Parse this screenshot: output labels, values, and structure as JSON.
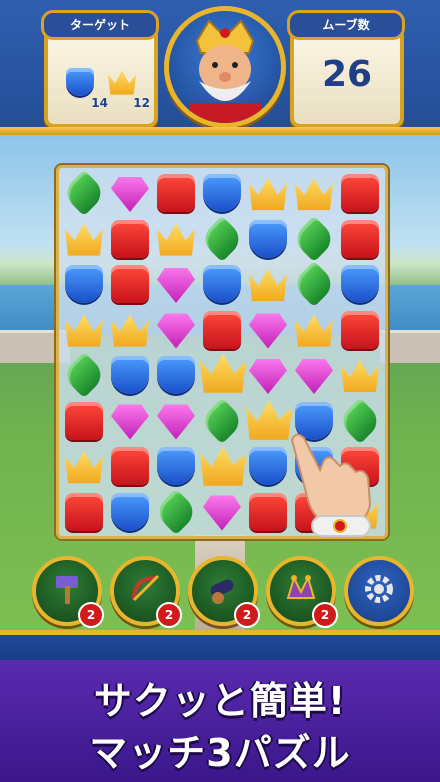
{
  "hud": {
    "target_title": "ターゲット",
    "moves_title": "ムーブ数",
    "moves_value": "26",
    "targets": [
      {
        "icon": "blue-shield-icon",
        "count": "14"
      },
      {
        "icon": "gold-crown-icon",
        "count": "12"
      }
    ]
  },
  "board": {
    "rows": [
      [
        "green",
        "purple",
        "red",
        "blue",
        "crown",
        "crown",
        "red"
      ],
      [
        "crown",
        "red",
        "crown",
        "green",
        "blue",
        "green",
        "red"
      ],
      [
        "blue",
        "red",
        "purple",
        "blue",
        "crown",
        "green",
        "blue"
      ],
      [
        "crown",
        "crown",
        "purple",
        "red",
        "purple",
        "crown",
        "red"
      ],
      [
        "green",
        "blue",
        "blue",
        "crown",
        "purple",
        "purple",
        "crown"
      ],
      [
        "red",
        "purple",
        "purple",
        "green",
        "crown",
        "blue",
        "green"
      ],
      [
        "crown",
        "red",
        "blue",
        "crown",
        "blue",
        "blue",
        "red"
      ],
      [
        "red",
        "blue",
        "green",
        "purple",
        "red",
        "red",
        "crown"
      ]
    ]
  },
  "boosters": [
    {
      "icon": "hammer-icon",
      "count": "2"
    },
    {
      "icon": "bow-arrow-icon",
      "count": "2"
    },
    {
      "icon": "cannon-icon",
      "count": "2"
    },
    {
      "icon": "jester-hat-icon",
      "count": "2"
    },
    {
      "icon": "gear-icon"
    }
  ],
  "banner": {
    "line1": "サクッと簡単!",
    "line2": "マッチ3パズル"
  },
  "colors": {
    "hud_blue": "#2f5fb0",
    "gold": "#e8b52c",
    "banner_purple": "#5a2bb0"
  }
}
